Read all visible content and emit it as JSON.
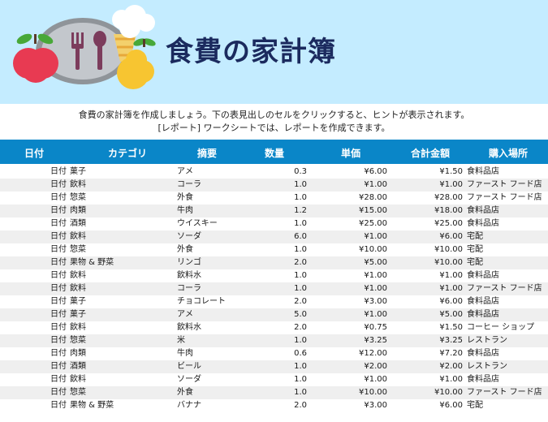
{
  "header": {
    "title": "食費の家計簿"
  },
  "intro": {
    "line1": "食費の家計簿を作成しましょう。下の表見出しのセルをクリックすると、ヒントが表示されます。",
    "line2": "[レポート] ワークシートでは、レポートを作成できます。"
  },
  "table": {
    "columns": [
      "日付",
      "カテゴリ",
      "摘要",
      "数量",
      "単価",
      "合計金額",
      "購入場所"
    ],
    "rows": [
      {
        "date": "日付",
        "category": "菓子",
        "description": "アメ",
        "quantity": "0.3",
        "unit_price": "¥6.00",
        "total": "¥1.50",
        "place": "食料品店"
      },
      {
        "date": "日付",
        "category": "飲料",
        "description": "コーラ",
        "quantity": "1.0",
        "unit_price": "¥1.00",
        "total": "¥1.00",
        "place": "ファースト フード店"
      },
      {
        "date": "日付",
        "category": "惣菜",
        "description": "外食",
        "quantity": "1.0",
        "unit_price": "¥28.00",
        "total": "¥28.00",
        "place": "ファースト フード店"
      },
      {
        "date": "日付",
        "category": "肉類",
        "description": "牛肉",
        "quantity": "1.2",
        "unit_price": "¥15.00",
        "total": "¥18.00",
        "place": "食料品店"
      },
      {
        "date": "日付",
        "category": "酒類",
        "description": "ウイスキー",
        "quantity": "1.0",
        "unit_price": "¥25.00",
        "total": "¥25.00",
        "place": "食料品店"
      },
      {
        "date": "日付",
        "category": "飲料",
        "description": "ソーダ",
        "quantity": "6.0",
        "unit_price": "¥1.00",
        "total": "¥6.00",
        "place": "宅配"
      },
      {
        "date": "日付",
        "category": "惣菜",
        "description": "外食",
        "quantity": "1.0",
        "unit_price": "¥10.00",
        "total": "¥10.00",
        "place": "宅配"
      },
      {
        "date": "日付",
        "category": "果物 & 野菜",
        "description": "リンゴ",
        "quantity": "2.0",
        "unit_price": "¥5.00",
        "total": "¥10.00",
        "place": "宅配"
      },
      {
        "date": "日付",
        "category": "飲料",
        "description": "飲料水",
        "quantity": "1.0",
        "unit_price": "¥1.00",
        "total": "¥1.00",
        "place": "食料品店"
      },
      {
        "date": "日付",
        "category": "飲料",
        "description": "コーラ",
        "quantity": "1.0",
        "unit_price": "¥1.00",
        "total": "¥1.00",
        "place": "ファースト フード店"
      },
      {
        "date": "日付",
        "category": "菓子",
        "description": "チョコレート",
        "quantity": "2.0",
        "unit_price": "¥3.00",
        "total": "¥6.00",
        "place": "食料品店"
      },
      {
        "date": "日付",
        "category": "菓子",
        "description": "アメ",
        "quantity": "5.0",
        "unit_price": "¥1.00",
        "total": "¥5.00",
        "place": "食料品店"
      },
      {
        "date": "日付",
        "category": "飲料",
        "description": "飲料水",
        "quantity": "2.0",
        "unit_price": "¥0.75",
        "total": "¥1.50",
        "place": "コーヒー ショップ"
      },
      {
        "date": "日付",
        "category": "惣菜",
        "description": "米",
        "quantity": "1.0",
        "unit_price": "¥3.25",
        "total": "¥3.25",
        "place": "レストラン"
      },
      {
        "date": "日付",
        "category": "肉類",
        "description": "牛肉",
        "quantity": "0.6",
        "unit_price": "¥12.00",
        "total": "¥7.20",
        "place": "食料品店"
      },
      {
        "date": "日付",
        "category": "酒類",
        "description": "ビール",
        "quantity": "1.0",
        "unit_price": "¥2.00",
        "total": "¥2.00",
        "place": "レストラン"
      },
      {
        "date": "日付",
        "category": "飲料",
        "description": "ソーダ",
        "quantity": "1.0",
        "unit_price": "¥1.00",
        "total": "¥1.00",
        "place": "食料品店"
      },
      {
        "date": "日付",
        "category": "惣菜",
        "description": "外食",
        "quantity": "1.0",
        "unit_price": "¥10.00",
        "total": "¥10.00",
        "place": "ファースト フード店"
      },
      {
        "date": "日付",
        "category": "果物 & 野菜",
        "description": "バナナ",
        "quantity": "2.0",
        "unit_price": "¥3.00",
        "total": "¥6.00",
        "place": "宅配"
      }
    ]
  }
}
